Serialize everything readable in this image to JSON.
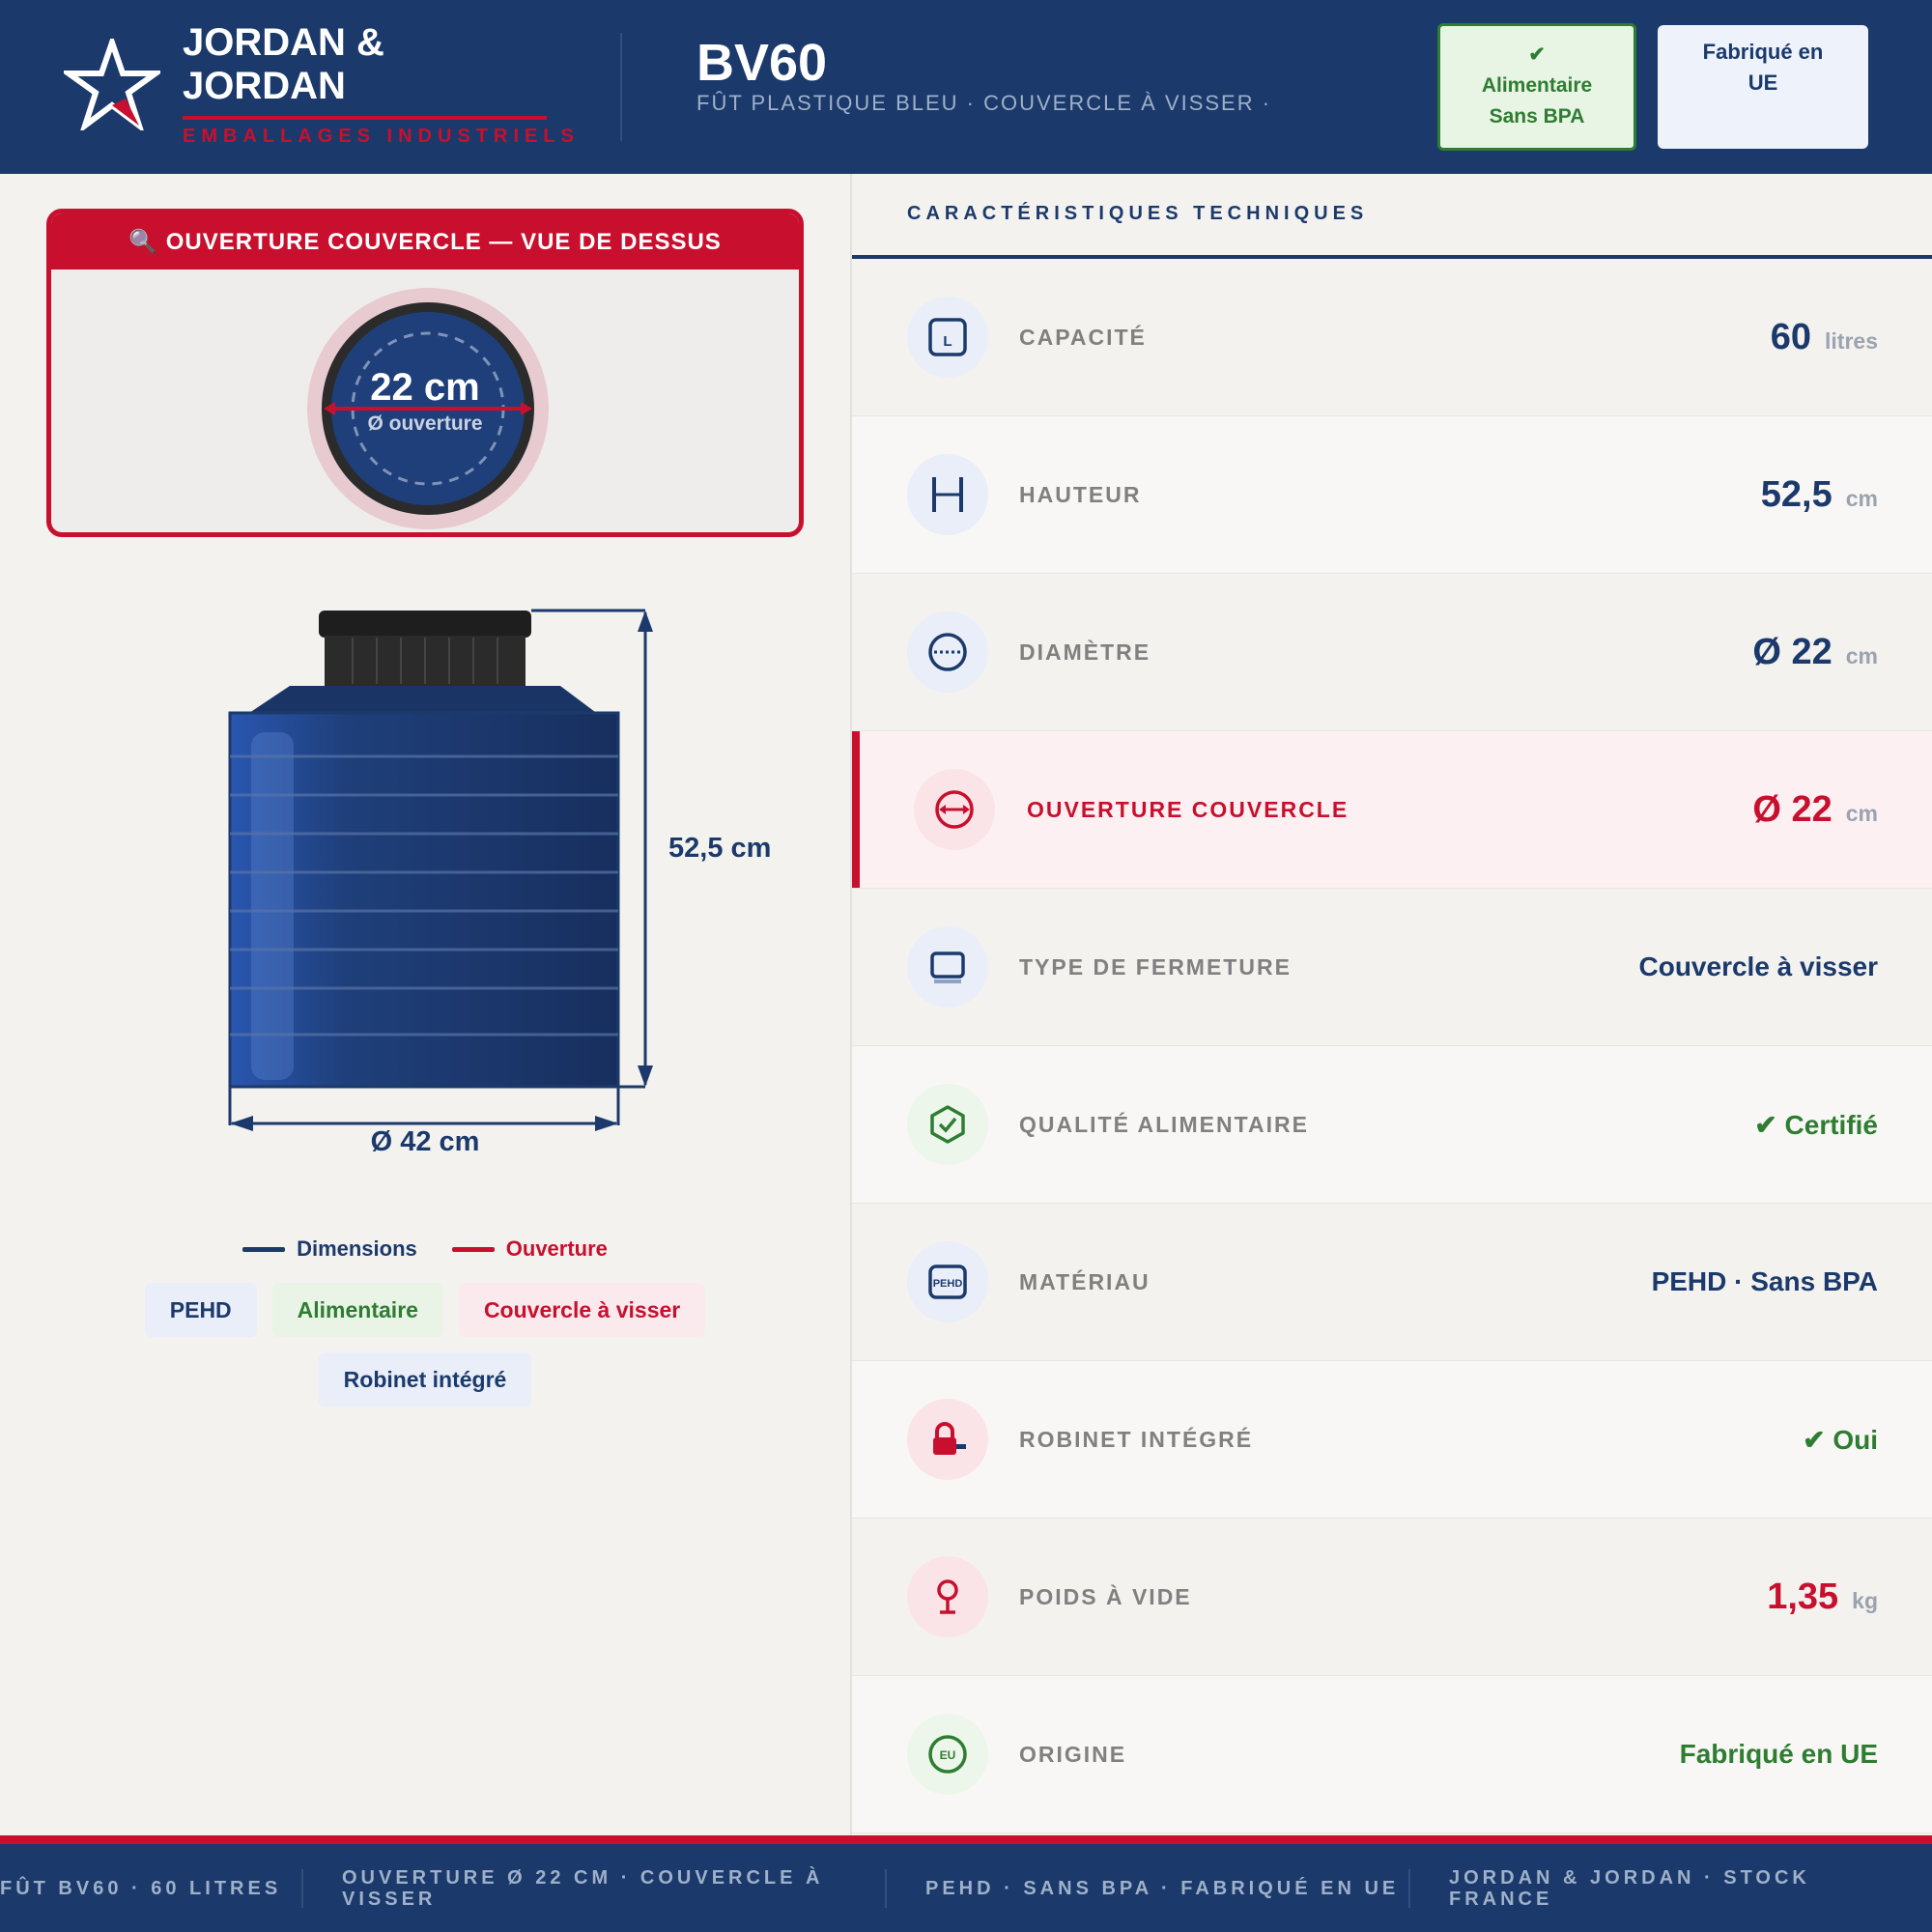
{
  "header": {
    "brand_line1": "JORDAN &",
    "brand_line2": "JORDAN",
    "brand_sub": "EMBALLAGES INDUSTRIELS",
    "model": "BV60",
    "model_desc": "FÛT PLASTIQUE BLEU · COUVERCLE À VISSER ·",
    "badge_food_check": "✔",
    "badge_food_line1": "Alimentaire",
    "badge_food_line2": "Sans BPA",
    "badge_eu": "Fabriqué en UE"
  },
  "top_view": {
    "title": "🔍 OUVERTURE COUVERCLE — VUE DE DESSUS",
    "value": "22 cm",
    "sub": "Ø ouverture"
  },
  "drum": {
    "height_label": "52,5 cm",
    "diameter_label": "Ø 42 cm"
  },
  "legend": {
    "dimensions": "Dimensions",
    "opening": "Ouverture"
  },
  "tags": [
    {
      "label": "PEHD"
    },
    {
      "label": "Alimentaire"
    },
    {
      "label": "Couvercle à visser"
    },
    {
      "label": "Robinet intégré"
    }
  ],
  "specs": {
    "title": "CARACTÉRISTIQUES TECHNIQUES",
    "rows": [
      {
        "label": "CAPACITÉ",
        "value": "60",
        "unit": "litres",
        "icon": "capacity-icon",
        "icon_text": "L"
      },
      {
        "label": "HAUTEUR",
        "value": "52,5",
        "unit": "cm",
        "icon": "height-icon"
      },
      {
        "label": "DIAMÈTRE",
        "value": "Ø 22",
        "unit": "cm",
        "icon": "diameter-icon"
      },
      {
        "label": "OUVERTURE COUVERCLE",
        "value": "Ø 22",
        "unit": "cm",
        "icon": "opening-icon"
      },
      {
        "label": "TYPE DE FERMETURE",
        "value": "Couvercle à visser",
        "icon": "lid-icon"
      },
      {
        "label": "QUALITÉ ALIMENTAIRE",
        "value": "✔ Certifié",
        "icon": "shield-check-icon"
      },
      {
        "label": "MATÉRIAU",
        "value": "PEHD · Sans BPA",
        "icon": "material-icon",
        "icon_text": "PEHD"
      },
      {
        "label": "ROBINET INTÉGRÉ",
        "value": "✔ Oui",
        "icon": "tap-icon"
      },
      {
        "label": "POIDS À VIDE",
        "value": "1,35",
        "unit": "kg",
        "icon": "weight-icon"
      },
      {
        "label": "ORIGINE",
        "value": "Fabriqué en UE",
        "icon": "eu-icon",
        "icon_text": "EU"
      }
    ]
  },
  "footer": {
    "item1": "FÛT BV60 · 60 LITRES",
    "item2": "OUVERTURE Ø 22 CM · COUVERCLE À VISSER",
    "item3": "PEHD · SANS BPA · FABRIQUÉ EN UE",
    "item4": "JORDAN & JORDAN · STOCK FRANCE"
  },
  "colors": {
    "navy": "#1b3a6b",
    "red": "#c8102e",
    "green": "#2e7d32"
  }
}
